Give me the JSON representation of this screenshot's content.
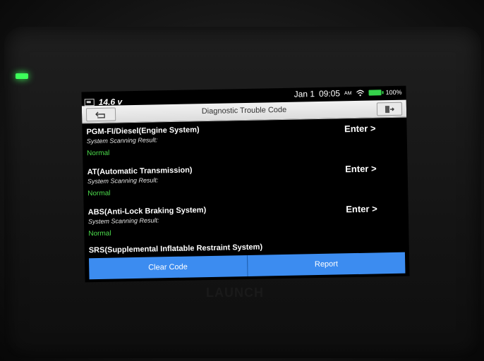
{
  "status_bar": {
    "battery_voltage": "14.6 v",
    "date": "Jan 1",
    "time": "09:05",
    "ampm": "AM",
    "battery_percent": "100%"
  },
  "header": {
    "title": "Diagnostic Trouble Code"
  },
  "systems": [
    {
      "name": "PGM-FI/Diesel(Engine System)",
      "scan_label": "System Scanning Result:",
      "status": "Normal",
      "action": "Enter >"
    },
    {
      "name": "AT(Automatic Transmission)",
      "scan_label": "System Scanning Result:",
      "status": "Normal",
      "action": "Enter >"
    },
    {
      "name": "ABS(Anti-Lock Braking System)",
      "scan_label": "System Scanning Result:",
      "status": "Normal",
      "action": "Enter >"
    },
    {
      "name": "SRS(Supplemental Inflatable Restraint System)"
    }
  ],
  "footer": {
    "clear_label": "Clear Code",
    "report_label": "Report"
  },
  "device": {
    "brand": "LAUNCH"
  },
  "colors": {
    "accent": "#3c8cf0",
    "status_ok": "#4cdd4c"
  }
}
